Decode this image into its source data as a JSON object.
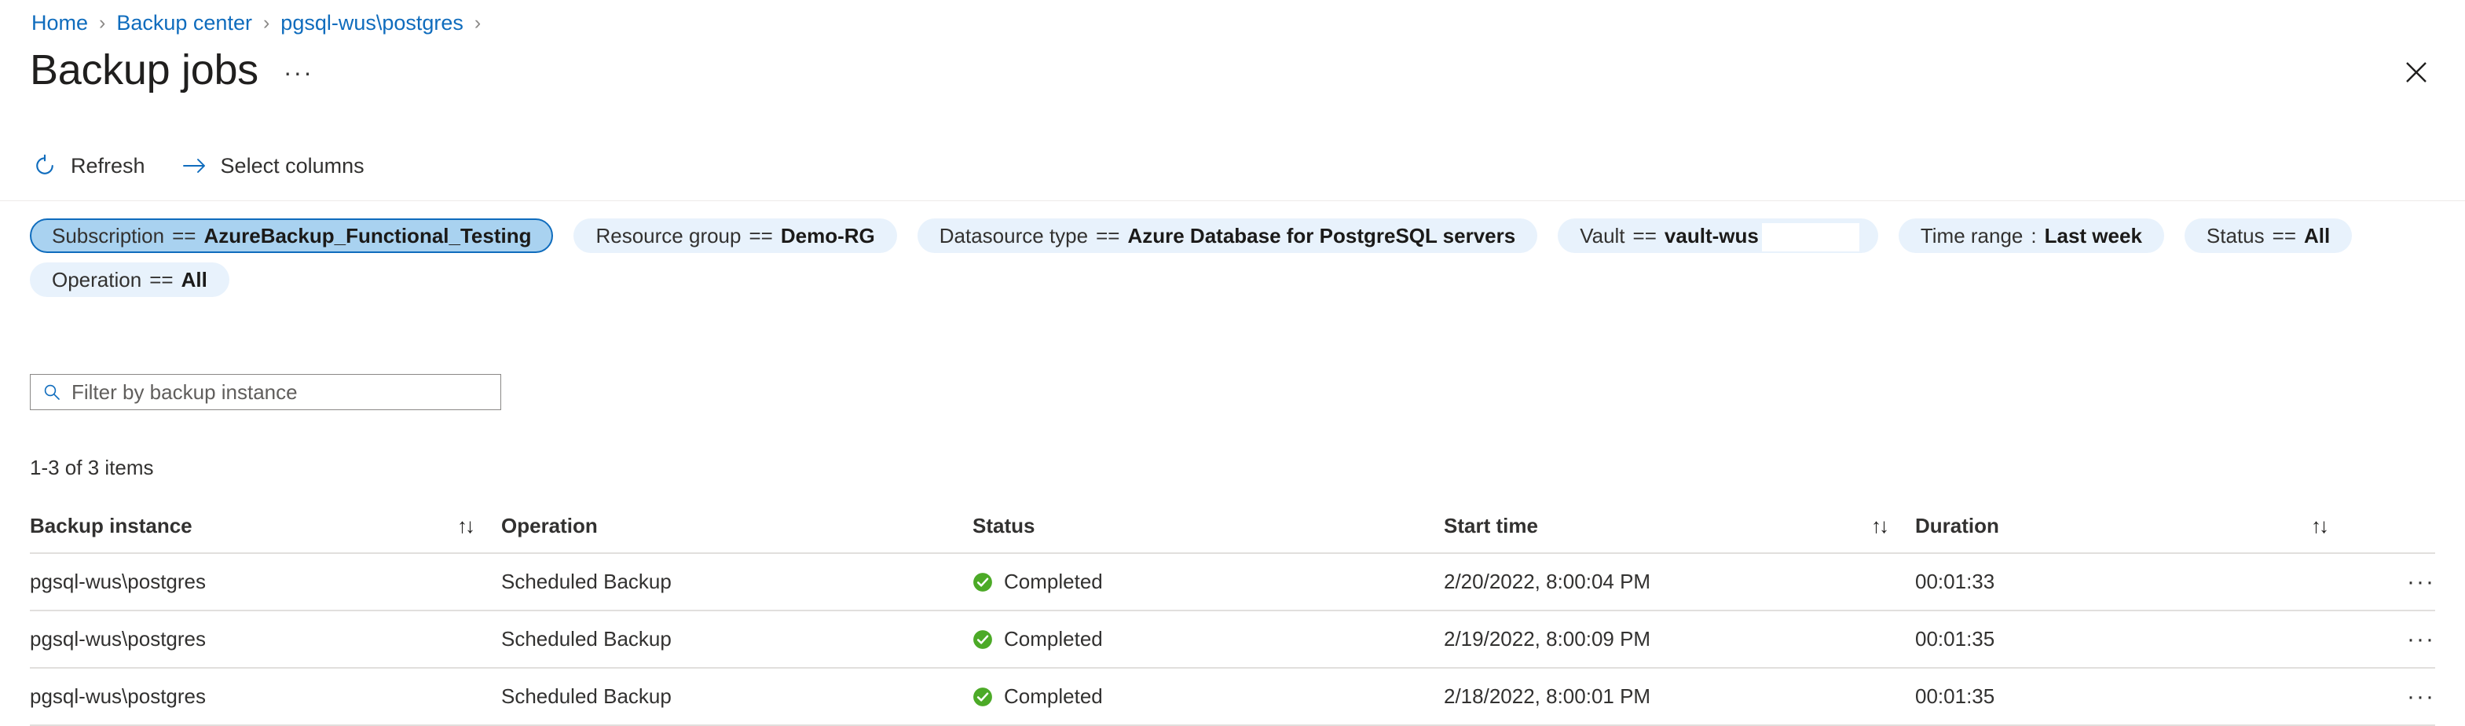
{
  "breadcrumb": {
    "items": [
      {
        "label": "Home"
      },
      {
        "label": "Backup center"
      },
      {
        "label": "pgsql-wus\\postgres"
      }
    ],
    "separator": "›"
  },
  "header": {
    "title": "Backup jobs",
    "more_label": "···",
    "close_icon": "close-icon"
  },
  "toolbar": {
    "refresh_label": "Refresh",
    "refresh_icon": "refresh-icon",
    "select_columns_label": "Select columns",
    "select_columns_icon": "arrow-right-icon"
  },
  "filters": {
    "rows": [
      [
        {
          "key": "Subscription",
          "op": "==",
          "value": "AzureBackup_Functional_Testing",
          "active": true,
          "gap": false
        },
        {
          "key": "Resource group",
          "op": "==",
          "value": "Demo-RG",
          "active": false,
          "gap": false
        },
        {
          "key": "Datasource type",
          "op": "==",
          "value": "Azure Database for PostgreSQL servers",
          "active": false,
          "gap": false
        },
        {
          "key": "Vault",
          "op": "==",
          "value": "vault-wus",
          "active": false,
          "gap": true
        },
        {
          "key": "Time range",
          "op": ":",
          "value": "Last week",
          "active": false,
          "gap": false
        },
        {
          "key": "Status",
          "op": "==",
          "value": "All",
          "active": false,
          "gap": false
        }
      ],
      [
        {
          "key": "Operation",
          "op": "==",
          "value": "All",
          "active": false,
          "gap": false
        }
      ]
    ]
  },
  "search": {
    "placeholder": "Filter by backup instance",
    "value": "",
    "icon": "search-icon"
  },
  "results": {
    "count_text": "1-3 of 3 items"
  },
  "table": {
    "columns": [
      {
        "label": "Backup instance",
        "sortable": true,
        "sort_icon": "↑↓"
      },
      {
        "label": "Operation",
        "sortable": false,
        "sort_icon": ""
      },
      {
        "label": "Status",
        "sortable": false,
        "sort_icon": ""
      },
      {
        "label": "Start time",
        "sortable": true,
        "sort_icon": "↑↓"
      },
      {
        "label": "Duration",
        "sortable": true,
        "sort_icon": "↑↓"
      },
      {
        "label": "",
        "sortable": false,
        "sort_icon": ""
      }
    ],
    "row_actions_label": "···",
    "status_icon": "success-check-icon",
    "status_color": "#4caa27",
    "rows": [
      {
        "instance": "pgsql-wus\\postgres",
        "operation": "Scheduled Backup",
        "status": "Completed",
        "start_time": "2/20/2022, 8:00:04 PM",
        "duration": "00:01:33"
      },
      {
        "instance": "pgsql-wus\\postgres",
        "operation": "Scheduled Backup",
        "status": "Completed",
        "start_time": "2/19/2022, 8:00:09 PM",
        "duration": "00:01:35"
      },
      {
        "instance": "pgsql-wus\\postgres",
        "operation": "Scheduled Backup",
        "status": "Completed",
        "start_time": "2/18/2022, 8:00:01 PM",
        "duration": "00:01:35"
      }
    ]
  },
  "colors": {
    "link": "#0f6cbd",
    "pill_bg": "#e8f2fc",
    "pill_active_bg": "#a9d2f0",
    "pill_active_border": "#0f6cbd",
    "success": "#4caa27"
  }
}
